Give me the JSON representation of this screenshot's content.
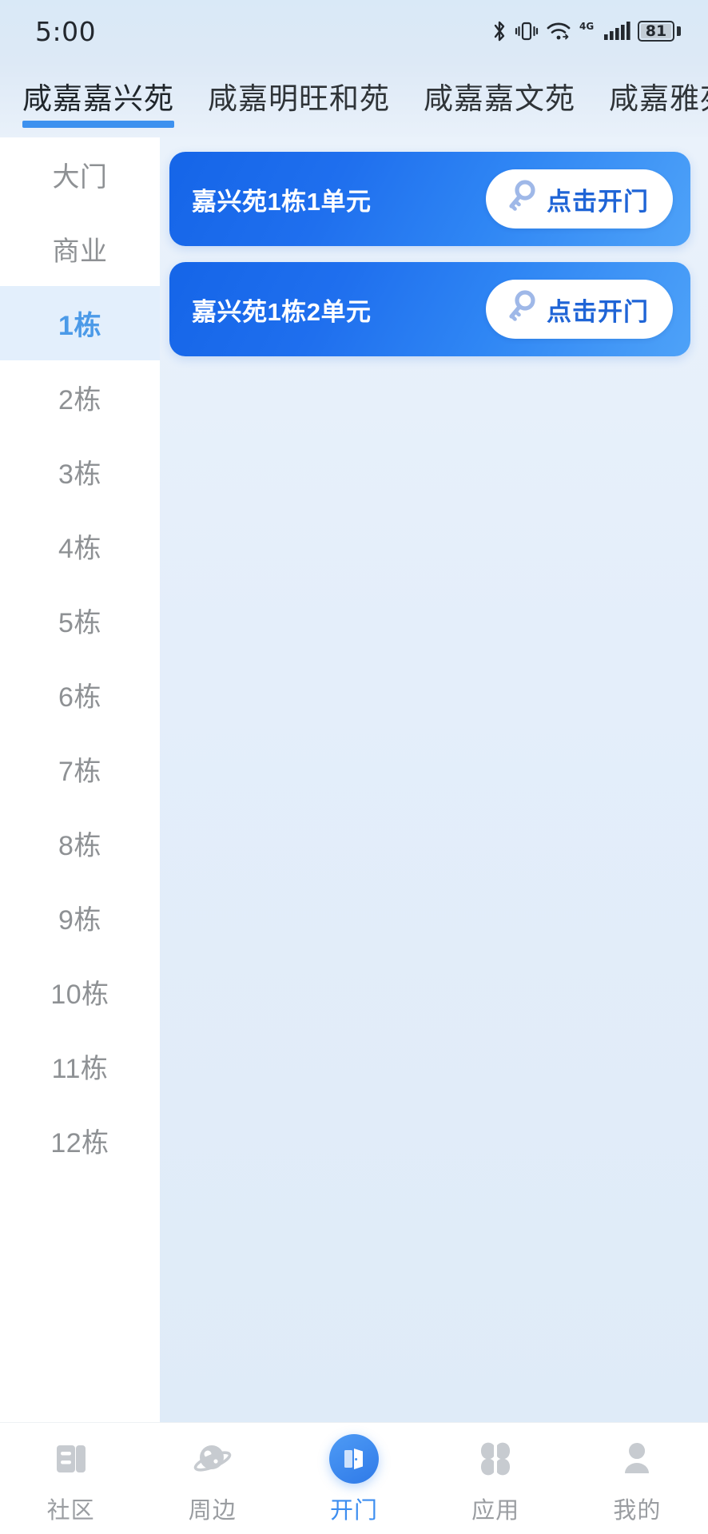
{
  "statusbar": {
    "time": "5:00",
    "battery_percent": "81",
    "network": "4G",
    "icons": [
      "bluetooth-icon",
      "vibrate-icon",
      "wifi-icon",
      "network-4g-icon",
      "signal-bars-icon",
      "battery-icon"
    ]
  },
  "tabs": {
    "items": [
      {
        "label": "咸嘉嘉兴苑",
        "active": true
      },
      {
        "label": "咸嘉明旺和苑",
        "active": false
      },
      {
        "label": "咸嘉嘉文苑",
        "active": false
      },
      {
        "label": "咸嘉雅苑",
        "active": false
      }
    ]
  },
  "sidebar": {
    "items": [
      {
        "label": "大门",
        "active": false
      },
      {
        "label": "商业",
        "active": false
      },
      {
        "label": "1栋",
        "active": true
      },
      {
        "label": "2栋",
        "active": false
      },
      {
        "label": "3栋",
        "active": false
      },
      {
        "label": "4栋",
        "active": false
      },
      {
        "label": "5栋",
        "active": false
      },
      {
        "label": "6栋",
        "active": false
      },
      {
        "label": "7栋",
        "active": false
      },
      {
        "label": "8栋",
        "active": false
      },
      {
        "label": "9栋",
        "active": false
      },
      {
        "label": "10栋",
        "active": false
      },
      {
        "label": "11栋",
        "active": false
      },
      {
        "label": "12栋",
        "active": false
      }
    ]
  },
  "content": {
    "doors": [
      {
        "name": "嘉兴苑1栋1单元",
        "button_label": "点击开门"
      },
      {
        "name": "嘉兴苑1栋2单元",
        "button_label": "点击开门"
      }
    ]
  },
  "bottomnav": {
    "items": [
      {
        "label": "社区",
        "icon": "community-icon",
        "active": false
      },
      {
        "label": "周边",
        "icon": "nearby-planet-icon",
        "active": false
      },
      {
        "label": "开门",
        "icon": "door-open-icon",
        "active": true
      },
      {
        "label": "应用",
        "icon": "apps-grid-icon",
        "active": false
      },
      {
        "label": "我的",
        "icon": "profile-person-icon",
        "active": false
      }
    ]
  },
  "colors": {
    "accent": "#3d91ef",
    "card_blue_dark": "#1565e8",
    "card_blue_light": "#4ea2f8",
    "sidebar_active_bg": "#e3effc",
    "sidebar_active_text": "#4b9ae8",
    "button_text": "#1f64d6",
    "muted_text": "#8e9194"
  }
}
